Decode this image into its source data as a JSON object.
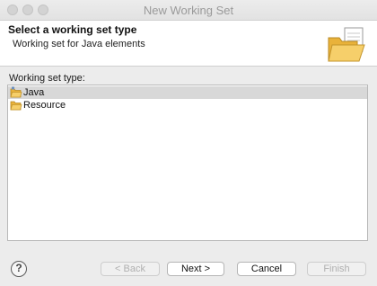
{
  "window": {
    "title": "New Working Set"
  },
  "banner": {
    "heading": "Select a working set type",
    "description": "Working set for Java elements",
    "icon": "open-folder-document-icon"
  },
  "list": {
    "label": "Working set type:",
    "items": [
      {
        "label": "Java",
        "icon": "java-folder-icon",
        "selected": true
      },
      {
        "label": "Resource",
        "icon": "folder-icon",
        "selected": false
      }
    ]
  },
  "buttons": {
    "help": "?",
    "back": "< Back",
    "next": "Next >",
    "cancel": "Cancel",
    "finish": "Finish"
  },
  "colors": {
    "selection": "#d8d8d8",
    "folder": "#f2c04b"
  }
}
